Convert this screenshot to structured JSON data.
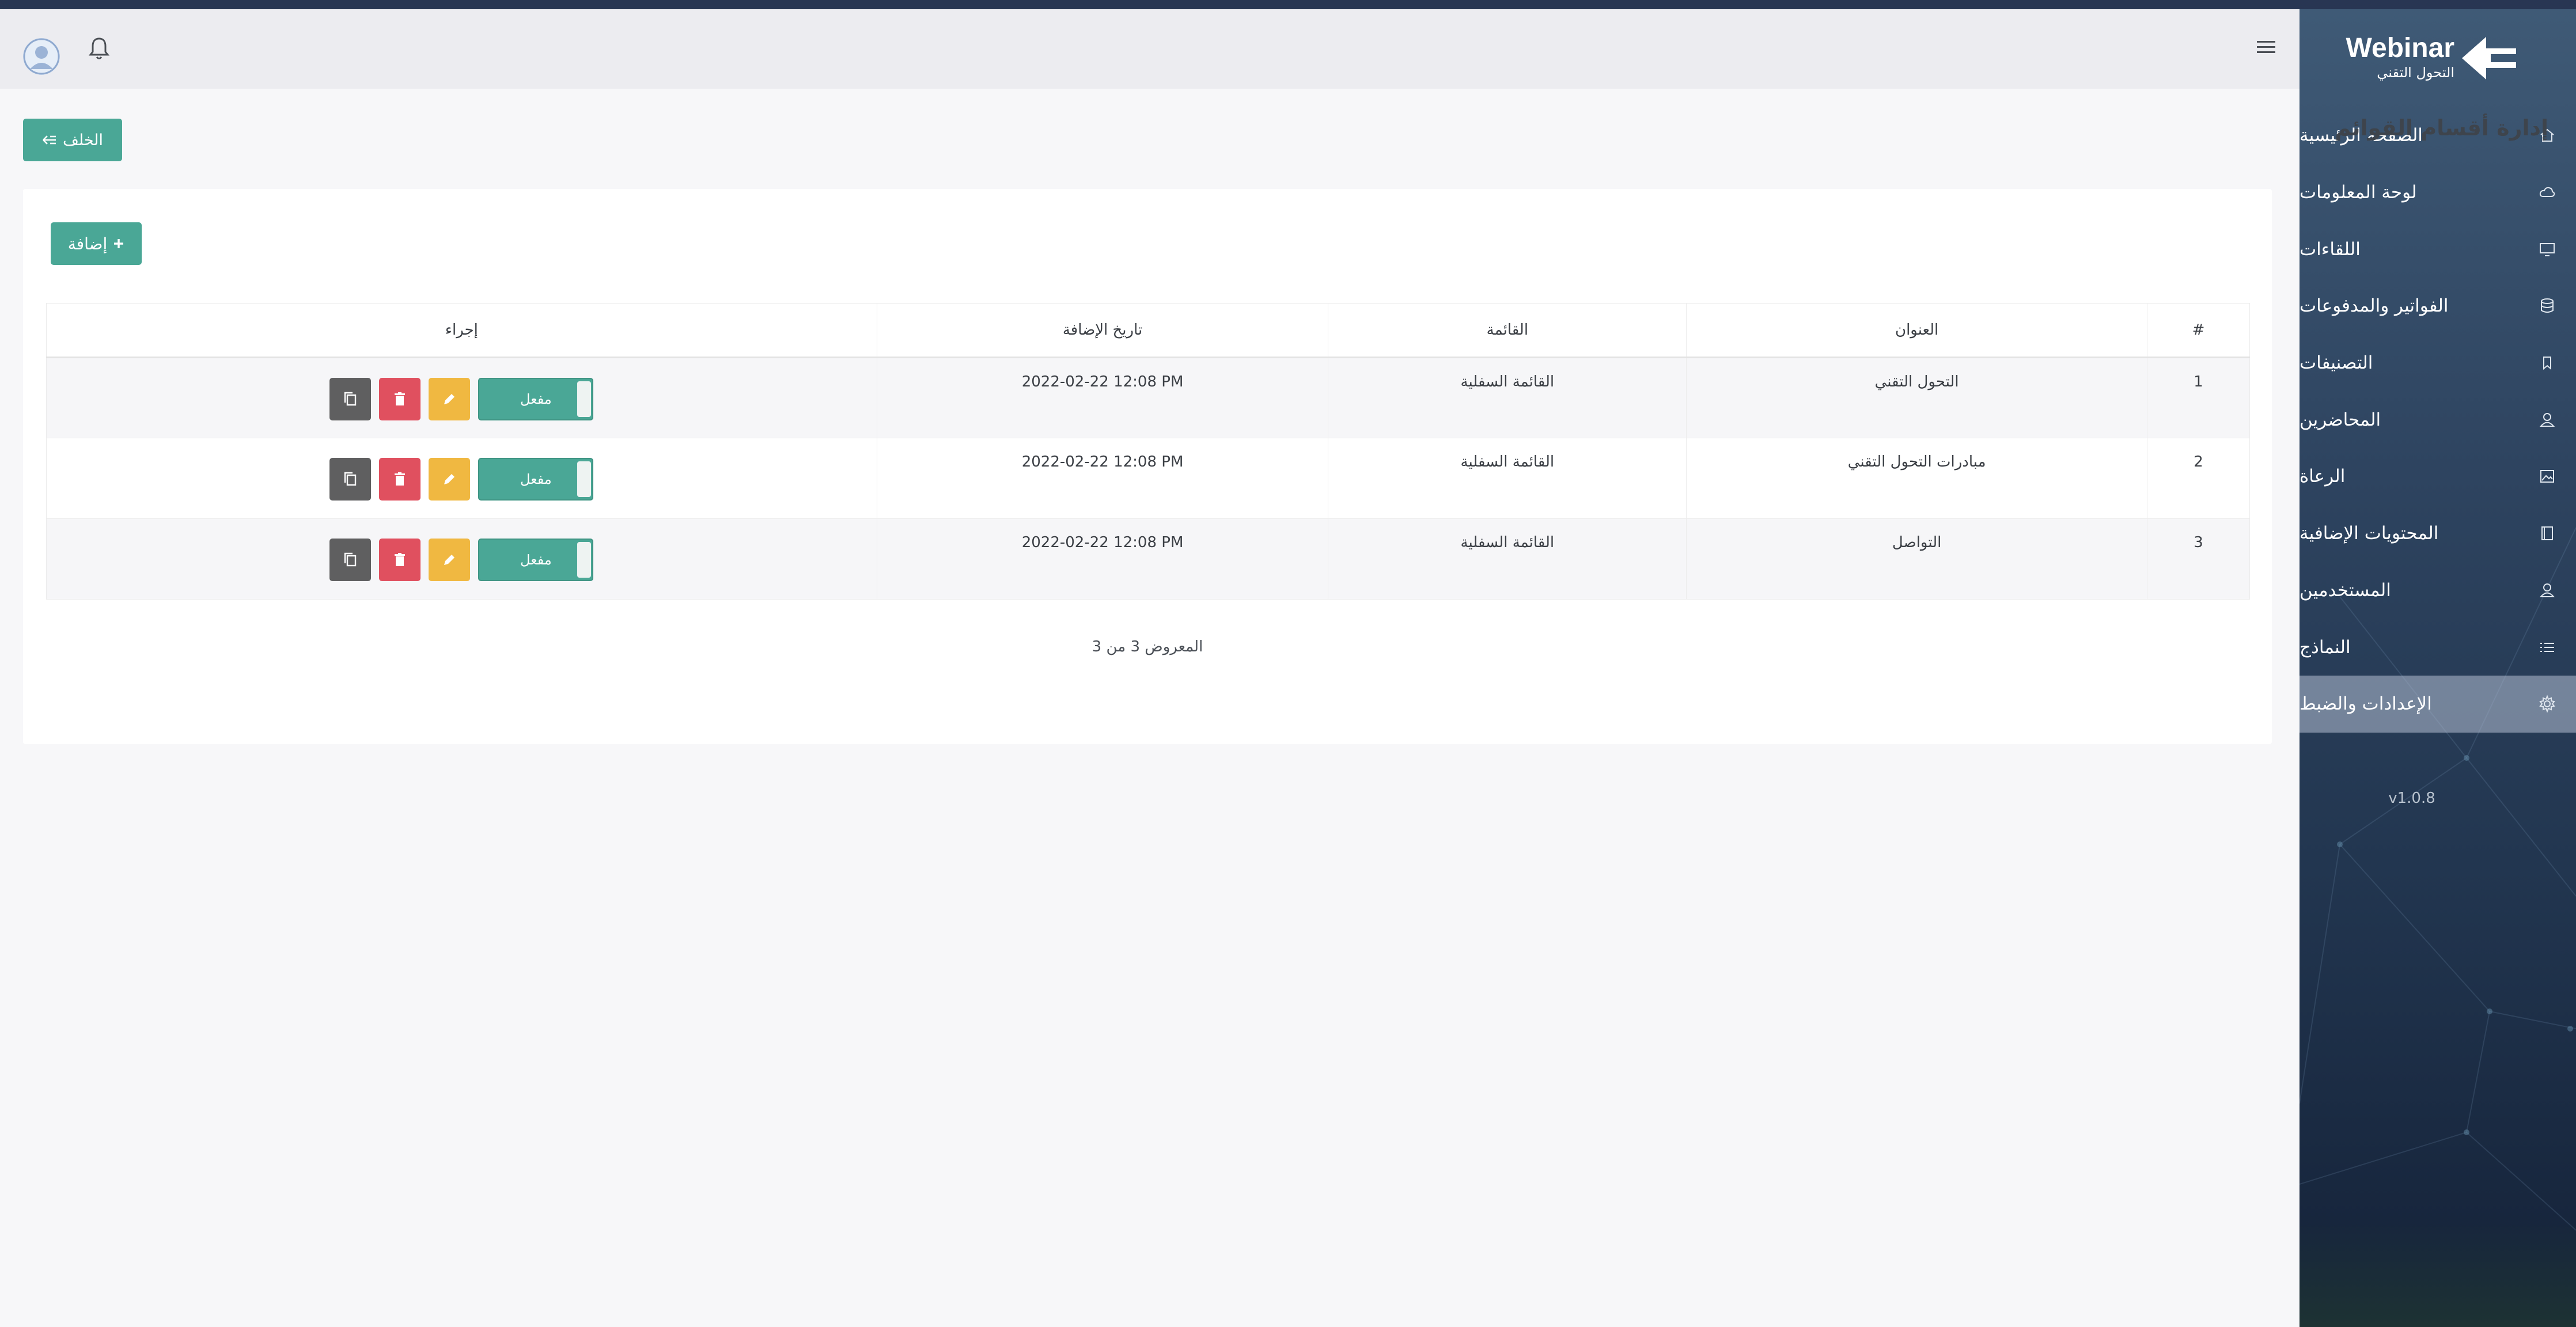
{
  "app": {
    "brand": "Webinar",
    "brand_subtitle": "التحول التقني",
    "version": "v1.0.8"
  },
  "sidebar": {
    "items": [
      {
        "label": "الصفحة الرئيسية",
        "icon": "home-icon",
        "active": false
      },
      {
        "label": "لوحة المعلومات",
        "icon": "cloud-icon",
        "active": false
      },
      {
        "label": "اللقاءات",
        "icon": "monitor-icon",
        "active": false
      },
      {
        "label": "الفواتير والمدفوعات",
        "icon": "database-icon",
        "active": false
      },
      {
        "label": "التصنيفات",
        "icon": "tag-icon",
        "active": false
      },
      {
        "label": "المحاضرين",
        "icon": "user-icon",
        "active": false
      },
      {
        "label": "الرعاة",
        "icon": "image-icon",
        "active": false
      },
      {
        "label": "المحتويات الإضافية",
        "icon": "book-icon",
        "active": false
      },
      {
        "label": "المستخدمين",
        "icon": "user-icon",
        "active": false
      },
      {
        "label": "النماذج",
        "icon": "list-icon",
        "active": false
      },
      {
        "label": "الإعدادات والضبط",
        "icon": "gear-icon",
        "active": true
      }
    ]
  },
  "page": {
    "title": "إدارة أقسام القوائم",
    "back_label": "الخلف",
    "add_label": "إضافة"
  },
  "table": {
    "headers": {
      "index": "#",
      "title": "العنوان",
      "menu": "القائمة",
      "date": "تاريخ الإضافة",
      "action": "إجراء"
    },
    "rows": [
      {
        "index": "1",
        "title": "التحول التقني",
        "menu": "القائمة السفلية",
        "date": "2022-02-22 12:08 PM",
        "status": "مفعل"
      },
      {
        "index": "2",
        "title": "مبادرات التحول التقني",
        "menu": "القائمة السفلية",
        "date": "2022-02-22 12:08 PM",
        "status": "مفعل"
      },
      {
        "index": "3",
        "title": "التواصل",
        "menu": "القائمة السفلية",
        "date": "2022-02-22 12:08 PM",
        "status": "مفعل"
      }
    ],
    "count_text": "المعروض 3 من 3"
  },
  "colors": {
    "accent": "#4aa796",
    "delete": "#e0505f",
    "edit": "#f0b841",
    "copy": "#5f5f60",
    "sidebar": "#2e4460"
  }
}
